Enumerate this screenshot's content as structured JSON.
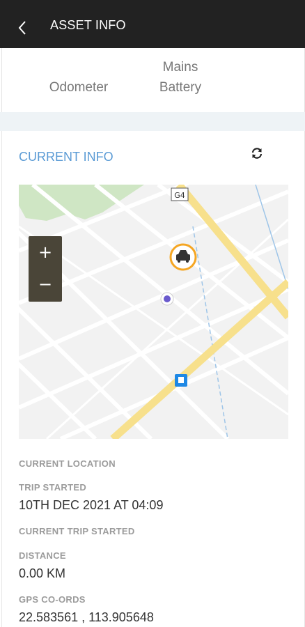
{
  "header": {
    "title": "ASSET INFO"
  },
  "stats": {
    "odometer_label": "Odometer",
    "mains_battery_line1": "Mains",
    "mains_battery_line2": "Battery"
  },
  "current_info": {
    "section_title": "CURRENT INFO",
    "map": {
      "road_marker": "G4",
      "zoom_in": "+",
      "zoom_out": "−",
      "vehicle_marker_color": "#f5a623"
    },
    "fields": {
      "current_location_label": "CURRENT LOCATION",
      "trip_started_label": "TRIP STARTED",
      "trip_started_value": "10TH DEC 2021 AT 04:09",
      "current_trip_started_label": "CURRENT TRIP STARTED",
      "distance_label": "DISTANCE",
      "distance_value": "0.00 KM",
      "gps_label": "GPS CO-ORDS",
      "gps_value": "22.583561 , 113.905648"
    }
  },
  "colors": {
    "appbar": "#222222",
    "accent": "#5b9bd5",
    "road_major": "#f7e08c"
  },
  "icons": {
    "back": "chevron-left-icon",
    "refresh": "refresh-icon",
    "vehicle": "car-icon"
  }
}
